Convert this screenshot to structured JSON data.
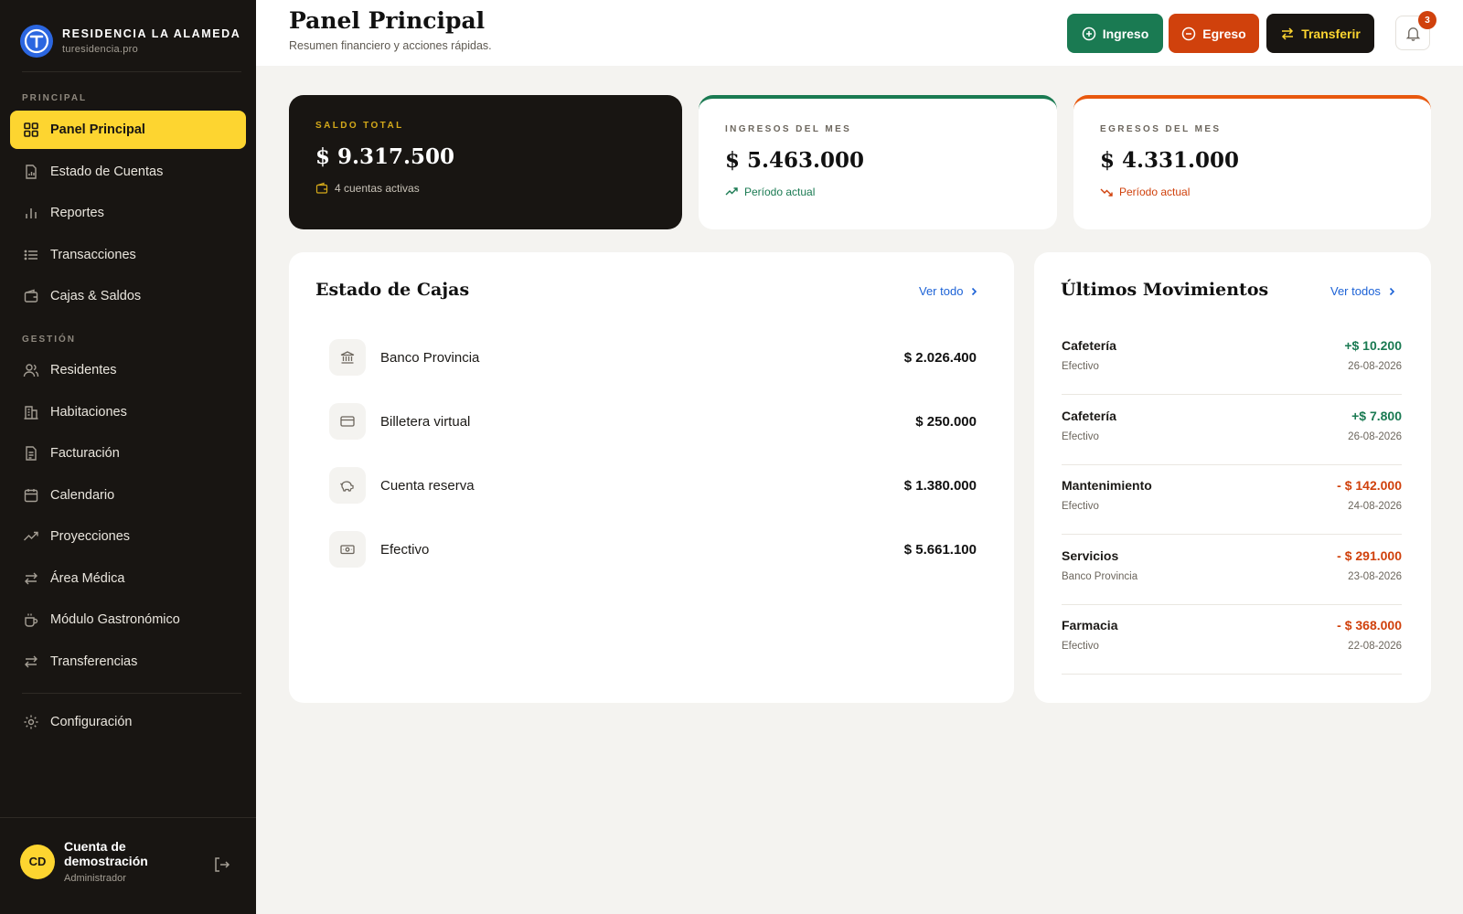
{
  "brand": {
    "name": "RESIDENCIA LA ALAMEDA",
    "url": "turesidencia.pro"
  },
  "sidebar": {
    "section_principal": "PRINCIPAL",
    "section_gestion": "GESTIÓN",
    "items": [
      {
        "label": "Panel Principal",
        "icon": "grid-icon",
        "active": true
      },
      {
        "label": "Estado de Cuentas",
        "icon": "report-icon"
      },
      {
        "label": "Reportes",
        "icon": "bar-chart-icon"
      },
      {
        "label": "Transacciones",
        "icon": "list-icon"
      },
      {
        "label": "Cajas & Saldos",
        "icon": "wallet-icon"
      },
      {
        "label": "Residentes",
        "icon": "users-icon"
      },
      {
        "label": "Habitaciones",
        "icon": "building-icon"
      },
      {
        "label": "Facturación",
        "icon": "invoice-icon"
      },
      {
        "label": "Calendario",
        "icon": "calendar-icon"
      },
      {
        "label": "Proyecciones",
        "icon": "trend-up-icon"
      },
      {
        "label": "Área Médica",
        "icon": "arrows-icon"
      },
      {
        "label": "Módulo Gastronómico",
        "icon": "coffee-icon"
      },
      {
        "label": "Transferencias",
        "icon": "arrows-icon"
      },
      {
        "label": "Configuración",
        "icon": "gear-icon"
      }
    ]
  },
  "user": {
    "initials": "CD",
    "name": "Cuenta de demostración",
    "role": "Administrador"
  },
  "header": {
    "title": "Panel Principal",
    "subtitle": "Resumen financiero y acciones rápidas.",
    "btn_ingreso": "Ingreso",
    "btn_egreso": "Egreso",
    "btn_transferir": "Transferir",
    "notifications": "3"
  },
  "stats": {
    "saldo": {
      "label": "SALDO TOTAL",
      "value": "$ 9.317.500",
      "foot": "4 cuentas activas"
    },
    "ingresos": {
      "label": "INGRESOS DEL MES",
      "value": "$ 5.463.000",
      "foot": "Período actual"
    },
    "egresos": {
      "label": "EGRESOS DEL MES",
      "value": "$ 4.331.000",
      "foot": "Período actual"
    }
  },
  "cajas": {
    "title": "Estado de Cajas",
    "link": "Ver todo",
    "items": [
      {
        "name": "Banco Provincia",
        "amount": "$ 2.026.400",
        "icon": "bank-icon"
      },
      {
        "name": "Billetera virtual",
        "amount": "$ 250.000",
        "icon": "card-icon"
      },
      {
        "name": "Cuenta reserva",
        "amount": "$ 1.380.000",
        "icon": "piggy-bank-icon"
      },
      {
        "name": "Efectivo",
        "amount": "$ 5.661.100",
        "icon": "cash-icon"
      }
    ]
  },
  "movimientos": {
    "title": "Últimos Movimientos",
    "link": "Ver todos",
    "items": [
      {
        "name": "Cafetería",
        "account": "Efectivo",
        "amount": "+$ 10.200",
        "date": "26-08-2026",
        "type": "positive"
      },
      {
        "name": "Cafetería",
        "account": "Efectivo",
        "amount": "+$ 7.800",
        "date": "26-08-2026",
        "type": "positive"
      },
      {
        "name": "Mantenimiento",
        "account": "Efectivo",
        "amount": "- $ 142.000",
        "date": "24-08-2026",
        "type": "negative"
      },
      {
        "name": "Servicios",
        "account": "Banco Provincia",
        "amount": "- $ 291.000",
        "date": "23-08-2026",
        "type": "negative"
      },
      {
        "name": "Farmacia",
        "account": "Efectivo",
        "amount": "- $ 368.000",
        "date": "22-08-2026",
        "type": "negative"
      }
    ]
  },
  "colors": {
    "accent_yellow": "#fdd530",
    "dark": "#181512",
    "income_green": "#1a7a52",
    "expense_orange": "#d0410c",
    "link_blue": "#1c62d6"
  }
}
